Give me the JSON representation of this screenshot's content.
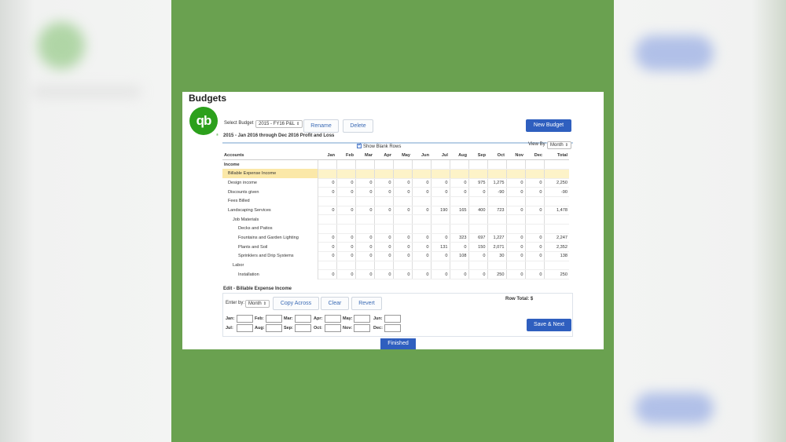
{
  "page": {
    "title": "Budgets",
    "logo_text": "qb",
    "logo_reg": "®"
  },
  "toolbar": {
    "select_budget_label": "Select Budget",
    "selected_budget": "2015 - FY16 P&L",
    "rename_label": "Rename",
    "delete_label": "Delete",
    "new_budget_label": "New Budget"
  },
  "report": {
    "subtitle": "2015 - Jan 2016 through Dec 2016 Profit and Loss",
    "show_blank_rows_label": "Show Blank Rows",
    "view_by_label": "View By",
    "view_by_value": "Month"
  },
  "grid": {
    "headers": [
      "Accounts",
      "Jan",
      "Feb",
      "Mar",
      "Apr",
      "May",
      "Jun",
      "Jul",
      "Aug",
      "Sep",
      "Oct",
      "Nov",
      "Dec",
      "Total"
    ],
    "rows": [
      {
        "label": "Income",
        "indent": 0,
        "section": true,
        "values": []
      },
      {
        "label": "Billable Expense Income",
        "indent": 1,
        "selected": true,
        "values": []
      },
      {
        "label": "Design income",
        "indent": 1,
        "values": [
          "0",
          "0",
          "0",
          "0",
          "0",
          "0",
          "0",
          "0",
          "975",
          "1,275",
          "0",
          "0",
          "2,250"
        ]
      },
      {
        "label": "Discounts given",
        "indent": 1,
        "values": [
          "0",
          "0",
          "0",
          "0",
          "0",
          "0",
          "0",
          "0",
          "0",
          "-90",
          "0",
          "0",
          "-90"
        ]
      },
      {
        "label": "Fees Billed",
        "indent": 1,
        "values": []
      },
      {
        "label": "Landscaping Services",
        "indent": 1,
        "values": [
          "0",
          "0",
          "0",
          "0",
          "0",
          "0",
          "190",
          "165",
          "400",
          "723",
          "0",
          "0",
          "1,478"
        ]
      },
      {
        "label": "Job Materials",
        "indent": 2,
        "values": []
      },
      {
        "label": "Decks and Patios",
        "indent": 3,
        "values": []
      },
      {
        "label": "Fountains and Garden Lighting",
        "indent": 3,
        "values": [
          "0",
          "0",
          "0",
          "0",
          "0",
          "0",
          "0",
          "323",
          "697",
          "1,227",
          "0",
          "0",
          "2,247"
        ]
      },
      {
        "label": "Plants and Soil",
        "indent": 3,
        "values": [
          "0",
          "0",
          "0",
          "0",
          "0",
          "0",
          "131",
          "0",
          "150",
          "2,071",
          "0",
          "0",
          "2,352"
        ]
      },
      {
        "label": "Sprinklers and Drip Systems",
        "indent": 3,
        "values": [
          "0",
          "0",
          "0",
          "0",
          "0",
          "0",
          "0",
          "108",
          "0",
          "30",
          "0",
          "0",
          "138"
        ]
      },
      {
        "label": "Labor",
        "indent": 2,
        "values": []
      },
      {
        "label": "Installation",
        "indent": 3,
        "values": [
          "0",
          "0",
          "0",
          "0",
          "0",
          "0",
          "0",
          "0",
          "0",
          "250",
          "0",
          "0",
          "250"
        ]
      }
    ]
  },
  "edit": {
    "title": "Edit - Billable Expense Income",
    "enter_by_label": "Enter by:",
    "enter_by_value": "Month",
    "copy_across_label": "Copy Across",
    "clear_label": "Clear",
    "revert_label": "Revert",
    "row_total_label": "Row Total: $",
    "months_row1": [
      "Jan:",
      "Feb:",
      "Mar:",
      "Apr:",
      "May:",
      "Jun:"
    ],
    "months_row2": [
      "Jul:",
      "Aug:",
      "Sep:",
      "Oct:",
      "Nov:",
      "Dec:"
    ],
    "save_next_label": "Save & Next"
  },
  "footer": {
    "finished_label": "Finished"
  },
  "colors": {
    "background_green": "#6aa150",
    "primary_blue": "#2f5fbf",
    "qb_green": "#2ca01c",
    "selected_row": "#fdf3c8"
  }
}
